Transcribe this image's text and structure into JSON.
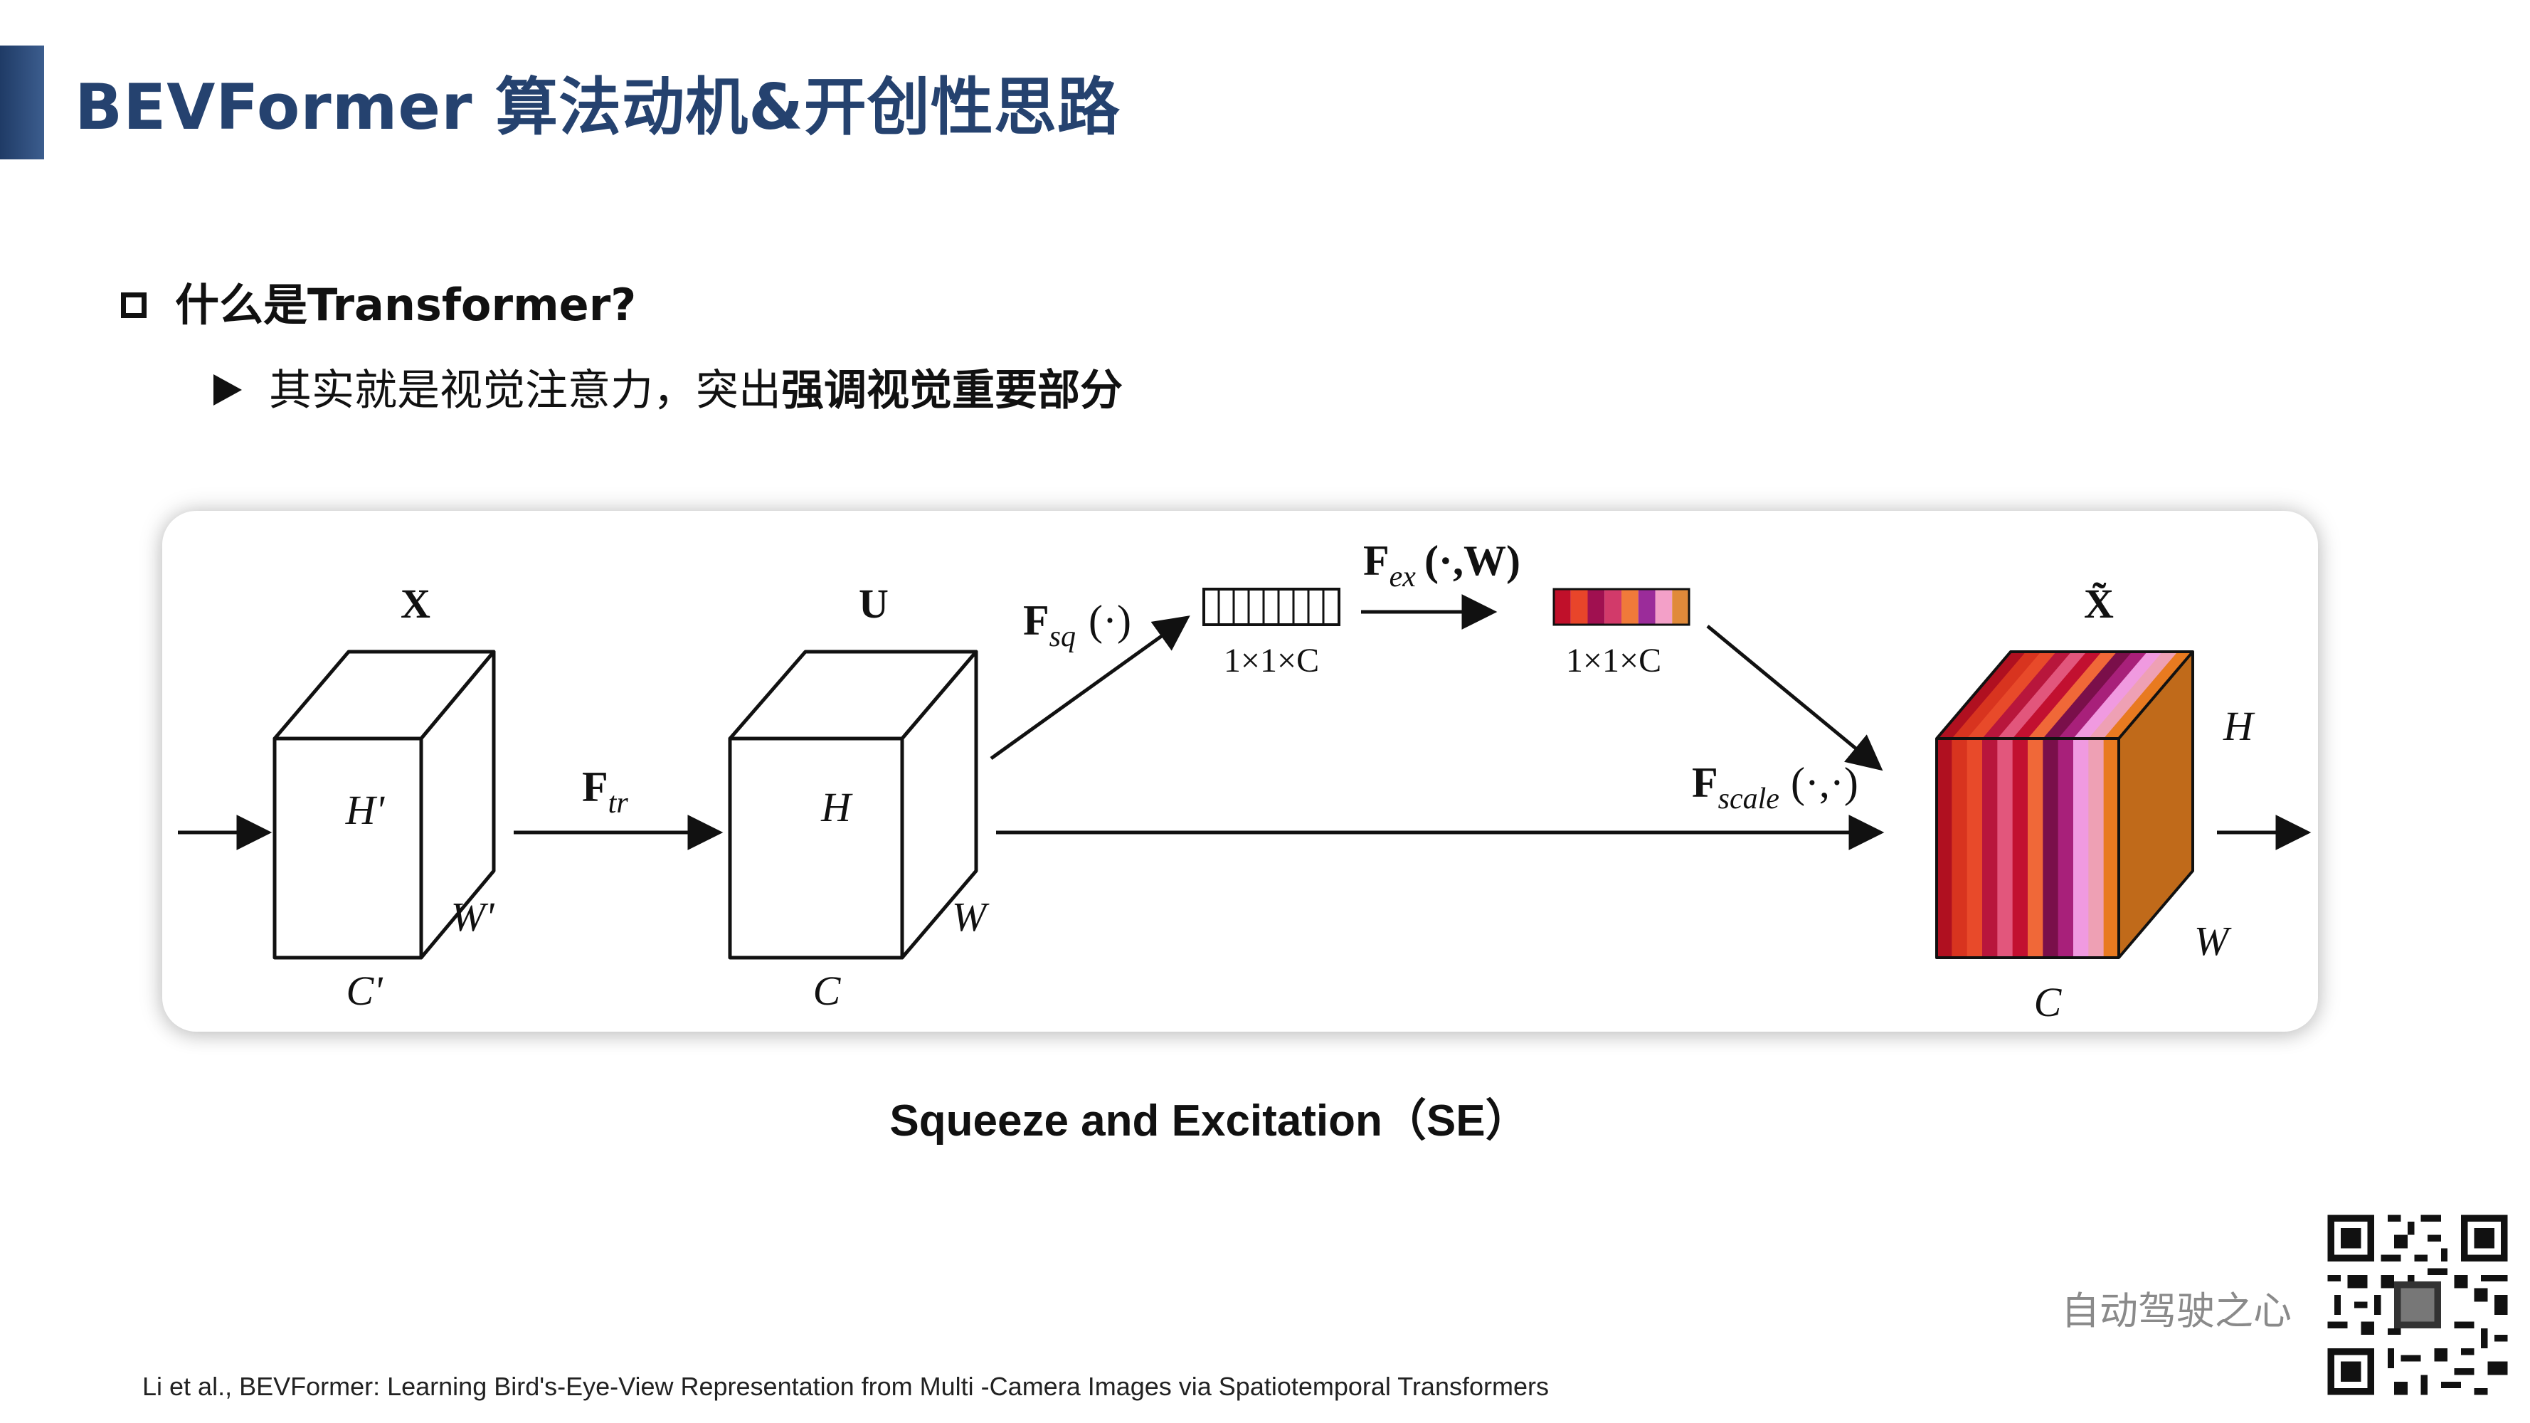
{
  "slide": {
    "title": "BEVFormer 算法动机&开创性思路",
    "bullet_heading": "什么是Transformer?",
    "sub_bullet_plain": "其实就是视觉注意力，突出",
    "sub_bullet_bold": "强调视觉重要部分",
    "caption": "Squeeze and Excitation（SE）",
    "brand": "自动驾驶之心",
    "citation": "Li et al., BEVFormer: Learning Bird's-Eye-View Representation from Multi -Camera Images via Spatiotemporal Transformers",
    "colors": {
      "title": "#25426f",
      "accent_bar": "#1f3b66",
      "brand": "#8a8a8a"
    }
  },
  "diagram": {
    "cube_x": {
      "label": "X",
      "height": "H'",
      "width": "W'",
      "channels": "C'"
    },
    "transform": {
      "main": "F",
      "sub": "tr"
    },
    "cube_u": {
      "label": "U",
      "height": "H",
      "width": "W",
      "channels": "C"
    },
    "squeeze": {
      "main": "F",
      "sub": "sq",
      "args": "(·)"
    },
    "vector_squeezed": {
      "dims": "1×1×C"
    },
    "excitation": {
      "main": "F",
      "sub": "ex",
      "args": "(·,W)"
    },
    "vector_excited": {
      "dims": "1×1×C",
      "colors": [
        "#c0102a",
        "#e8452a",
        "#a01050",
        "#d23a6a",
        "#f07a3a",
        "#9b2c9a",
        "#f3a0c8",
        "#e08a3a"
      ]
    },
    "scale": {
      "main": "F",
      "sub": "scale",
      "args": "(·,·)"
    },
    "cube_out": {
      "label": "X̃",
      "height": "H",
      "width": "W",
      "channels": "C",
      "slice_colors": [
        "#b01020",
        "#d8341f",
        "#e84a2a",
        "#b8163c",
        "#e2567c",
        "#c21030",
        "#f06838",
        "#7a0f4a",
        "#a8207a",
        "#f09ae0",
        "#eea0b4",
        "#e87a20"
      ],
      "side_color": "#c06a1a"
    }
  }
}
